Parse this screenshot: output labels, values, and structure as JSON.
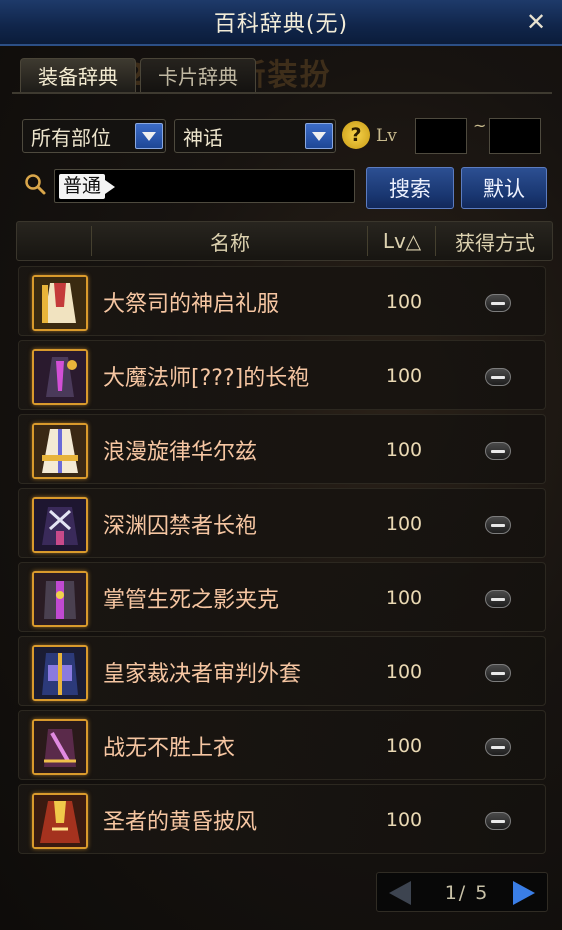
{
  "window": {
    "title": "百科辞典(无)",
    "close_glyph": "✕"
  },
  "background_text": "2020年全新装扮",
  "tabs": [
    {
      "label": "装备辞典",
      "active": true
    },
    {
      "label": "卡片辞典",
      "active": false
    }
  ],
  "filters": {
    "slot": "所有部位",
    "rarity": "神话",
    "help_glyph": "?",
    "lv_label": "Lv",
    "lv_separator": "~",
    "lv_min": "",
    "lv_max": ""
  },
  "search": {
    "chip": "普通",
    "value": "",
    "search_label": "搜索",
    "default_label": "默认"
  },
  "table": {
    "col_name": "名称",
    "col_lv": "Lv△",
    "col_method": "获得方式"
  },
  "items": [
    {
      "name": "大祭司的神启礼服",
      "lv": "100",
      "icon": "robe-icon"
    },
    {
      "name": "大魔法师[???]的长袍",
      "lv": "100",
      "icon": "robe-icon"
    },
    {
      "name": "浪漫旋律华尔兹",
      "lv": "100",
      "icon": "robe-icon"
    },
    {
      "name": "深渊囚禁者长袍",
      "lv": "100",
      "icon": "robe-icon"
    },
    {
      "name": "掌管生死之影夹克",
      "lv": "100",
      "icon": "jacket-icon"
    },
    {
      "name": "皇家裁决者审判外套",
      "lv": "100",
      "icon": "coat-icon"
    },
    {
      "name": "战无不胜上衣",
      "lv": "100",
      "icon": "top-icon"
    },
    {
      "name": "圣者的黄昏披风",
      "lv": "100",
      "icon": "cape-icon"
    }
  ],
  "pagination": {
    "text": "1/ 5",
    "current": 1,
    "total": 5
  },
  "colors": {
    "item_name": "#f6c6a2",
    "mythic_border": "#d99a2c",
    "accent_blue": "#3a7ee6",
    "titlebar": "#10254a"
  }
}
